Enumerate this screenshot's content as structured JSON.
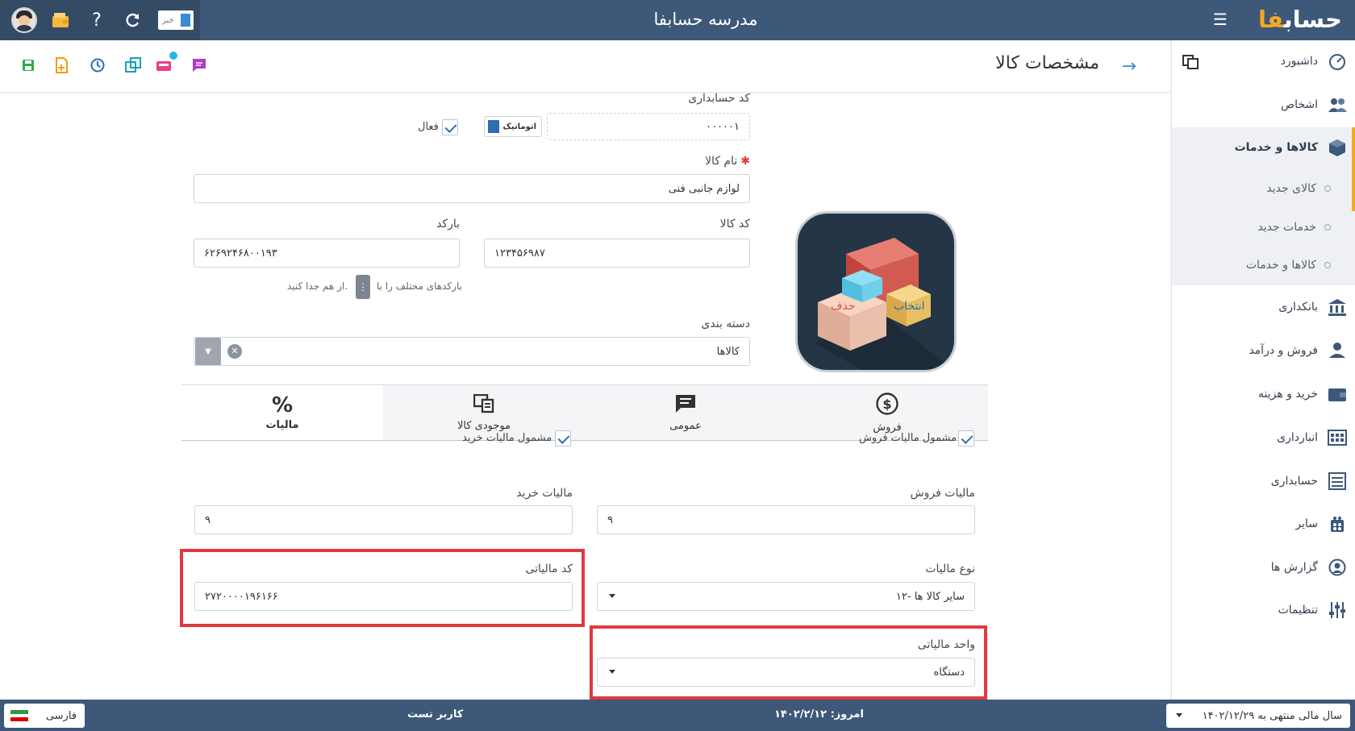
{
  "app": {
    "title": "مدرسه حسابفا",
    "logo_main": "حساب",
    "logo_accent": "فا",
    "news_label": "خبر"
  },
  "sidebar": {
    "items": [
      {
        "label": "داشبورد",
        "icon": "dashboard-icon"
      },
      {
        "label": "اشخاص",
        "icon": "people-icon"
      },
      {
        "label": "کالاها و خدمات",
        "icon": "box-icon",
        "active": true
      },
      {
        "label": "بانکداری",
        "icon": "bank-icon"
      },
      {
        "label": "فروش و درآمد",
        "icon": "sales-icon"
      },
      {
        "label": "خرید و هزینه",
        "icon": "wallet-icon"
      },
      {
        "label": "انبارداری",
        "icon": "warehouse-icon"
      },
      {
        "label": "حسابداری",
        "icon": "ledger-icon"
      },
      {
        "label": "سایر",
        "icon": "other-icon"
      },
      {
        "label": "گزارش ها",
        "icon": "report-icon"
      },
      {
        "label": "تنظیمات",
        "icon": "settings-icon"
      }
    ],
    "sub_items": [
      {
        "label": "کالای جدید"
      },
      {
        "label": "خدمات جدید"
      },
      {
        "label": "کالاها و خدمات"
      }
    ]
  },
  "header": {
    "page_title": "مشخصات کالا"
  },
  "form": {
    "accounting_code_label": "کد حسابداری",
    "accounting_code_value": "۰۰۰۰۰۱",
    "auto_label": "اتوماتیک",
    "active_label": "فعال",
    "name_label": "نام کالا",
    "name_value": "لوازم جانبی فنی",
    "code_label": "کد کالا",
    "code_value": "۱۲۳۴۵۶۹۸۷",
    "barcode_label": "بارکد",
    "barcode_value": "۶۲۶۹۲۴۶۸۰۰۱۹۳",
    "barcode_hint_pre": "بارکدهای مختلف را با",
    "barcode_hint_post": "از هم جدا کنید.",
    "category_label": "دسته بندی",
    "category_value": "کالاها",
    "image_select": "انتخاب",
    "image_delete": "حذف"
  },
  "tabs": [
    {
      "label": "فروش",
      "icon": "dollar-icon"
    },
    {
      "label": "عمومی",
      "icon": "comment-icon"
    },
    {
      "label": "موجودی کالا",
      "icon": "inventory-icon"
    },
    {
      "label": "مالیات",
      "icon": "percent-icon",
      "active": true
    }
  ],
  "tax": {
    "sales_tax_check": "مشمول مالیات فروش",
    "purchase_tax_check": "مشمول مالیات خرید",
    "sales_tax_label": "مالیات فروش",
    "sales_tax_value": "۹",
    "purchase_tax_label": "مالیات خرید",
    "purchase_tax_value": "۹",
    "tax_type_label": "نوع مالیات",
    "tax_type_value": "۱۲- سایر کالا ها",
    "tax_code_label": "کد مالیاتی",
    "tax_code_value": "۲۷۲۰۰۰۰۱۹۶۱۶۶",
    "tax_unit_label": "واحد مالیاتی",
    "tax_unit_value": "دستگاه"
  },
  "footer": {
    "language": "فارسی",
    "user": "کاربر تست",
    "today": "امروز: ۱۴۰۲/۲/۱۲",
    "fiscal_year": "سال مالی منتهی به ۱۴۰۲/۱۲/۲۹"
  },
  "colors": {
    "topbar": "#3d5878",
    "accent": "#f6a822",
    "highlight": "#e0393e"
  }
}
